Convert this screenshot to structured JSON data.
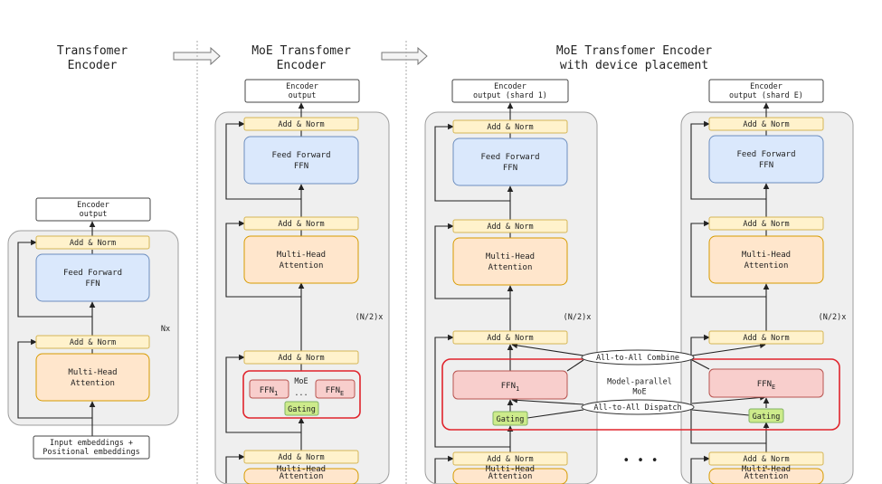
{
  "titles": {
    "left": [
      "Transfomer",
      "Encoder"
    ],
    "middle": [
      "MoE Transfomer",
      "Encoder"
    ],
    "right": [
      "MoE Transfomer Encoder",
      "with device placement"
    ]
  },
  "labels": {
    "encoder_output": [
      "Encoder",
      "output"
    ],
    "shard1_output": [
      "Encoder",
      "output (shard 1)"
    ],
    "shardE_output": [
      "Encoder",
      "output (shard E)"
    ],
    "add_norm": "Add & Norm",
    "ffn": [
      "Feed Forward",
      "FFN"
    ],
    "mha": [
      "Multi-Head",
      "Attention"
    ],
    "input": [
      "Input embeddings +",
      "Positional embeddings"
    ],
    "nx": "Nx",
    "n2x": "(N/2)x",
    "moe": "MoE",
    "ffn1": "FFN",
    "ffn1_sub": "1",
    "ffnE": "FFN",
    "ffnE_sub": "E",
    "ellipsis": "...",
    "gating": "Gating",
    "model_parallel": [
      "Model-parallel",
      "MoE"
    ],
    "combine": "All-to-All Combine",
    "dispatch": "All-to-All Dispatch",
    "more_devices": "• • •"
  },
  "colors": {
    "add_norm_fill": "#fff2cc",
    "add_norm_stroke": "#d6b656",
    "ffn_fill": "#dae8fc",
    "ffn_stroke": "#6c8ebf",
    "mha_fill": "#ffe6cc",
    "mha_stroke": "#d79b00",
    "expert_fill": "#f8cecc",
    "expert_stroke": "#b85450",
    "gating_fill": "#cdeb8b",
    "gating_stroke": "#82b366",
    "moe_stroke": "#e0242c",
    "container_fill": "#efefef",
    "container_stroke": "#9e9e9e"
  }
}
